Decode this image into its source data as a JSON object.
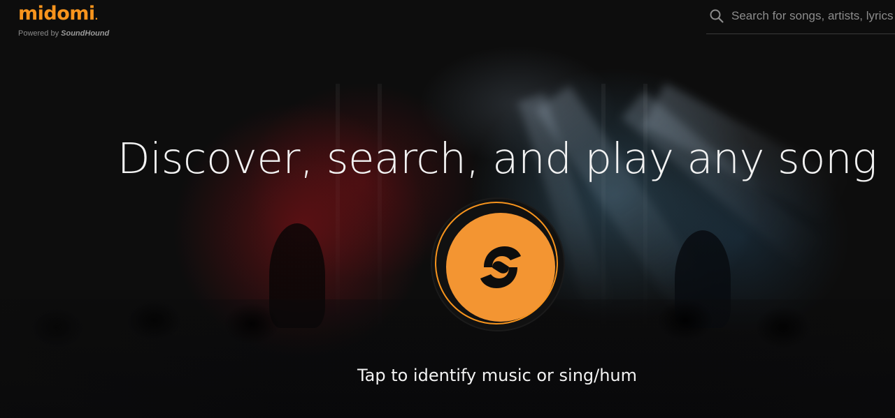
{
  "header": {
    "logo": {
      "wordmark": "midomi",
      "wordmark_dot": ".",
      "tagline_prefix": "Powered by",
      "tagline_brand": "SoundHound"
    },
    "search": {
      "placeholder": "Search for songs, artists, lyrics",
      "value": "",
      "icon": "search-icon"
    }
  },
  "hero": {
    "headline": "Discover, search, and play any song",
    "listen_button_icon": "soundhound-icon",
    "cta": "Tap to identify music or sing/hum"
  },
  "colors": {
    "accent": "#f7941d",
    "button_fill": "#f39532",
    "background": "#0d0d0d",
    "text": "#f2f2f2"
  }
}
